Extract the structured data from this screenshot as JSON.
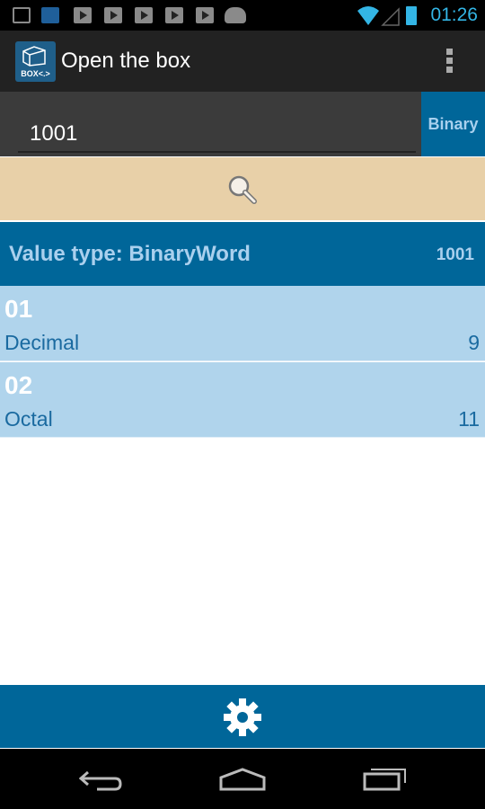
{
  "status_bar": {
    "time": "01:26",
    "icons": [
      "image-icon",
      "outlook-icon",
      "play-store-icon",
      "play-store-icon",
      "play-store-icon",
      "play-store-icon",
      "play-store-icon",
      "android-icon",
      "wifi-icon",
      "signal-icon",
      "battery-charging-icon"
    ]
  },
  "action_bar": {
    "title": "Open the box",
    "app_icon_text": "BOX<.>"
  },
  "input": {
    "value": "1001",
    "type_button": "Binary"
  },
  "result_header": {
    "title": "Value type: BinaryWord",
    "value": "1001"
  },
  "results": [
    {
      "index": "01",
      "label": "Decimal",
      "value": "9"
    },
    {
      "index": "02",
      "label": "Octal",
      "value": "11"
    }
  ],
  "colors": {
    "accent": "#006699",
    "search_bg": "#e8d0a8",
    "row_bg": "#b0d4ec",
    "status_clock": "#33b5e5"
  }
}
